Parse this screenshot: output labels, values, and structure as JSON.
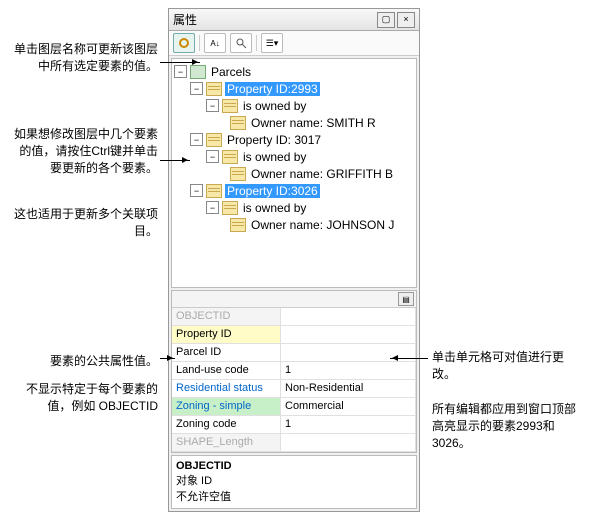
{
  "title": "属性",
  "tree": {
    "root": "Parcels",
    "n1": "Property ID:2993",
    "n1o": "is owned by",
    "n1own": "Owner name: SMITH R",
    "n2": "Property ID: 3017",
    "n2o": "is owned by",
    "n2own": "Owner name: GRIFFITH B",
    "n3": "Property ID:3026",
    "n3o": "is owned by",
    "n3own": "Owner name: JOHNSON J"
  },
  "grid": [
    {
      "k": "OBJECTID",
      "v": "",
      "cls": "dim"
    },
    {
      "k": "Property ID",
      "v": "",
      "cls": "hlY"
    },
    {
      "k": "Parcel ID",
      "v": ""
    },
    {
      "k": "Land-use code",
      "v": "1"
    },
    {
      "k": "Residential status",
      "v": "Non-Residential",
      "cls": "hlB"
    },
    {
      "k": "Zoning - simple",
      "v": "Commercial",
      "cls": "hlG"
    },
    {
      "k": "Zoning code",
      "v": "1"
    },
    {
      "k": "SHAPE_Length",
      "v": "",
      "cls": "dim"
    }
  ],
  "desc": {
    "h": "OBJECTID",
    "l1": "对象 ID",
    "l2": "不允许空值"
  },
  "ann": {
    "a1": "单击图层名称可更新该图层中所有选定要素的值。",
    "a2": "如果想修改图层中几个要素的值，请按住Ctrl键并单击要更新的各个要素。",
    "a3": "这也适用于更新多个关联项目。",
    "a4": "要素的公共属性值。",
    "a5": "不显示特定于每个要素的值，例如 OBJECTID",
    "a6": "单击单元格可对值进行更改。",
    "a7": "所有编辑都应用到窗口顶部高亮显示的要素2993和3026。"
  }
}
